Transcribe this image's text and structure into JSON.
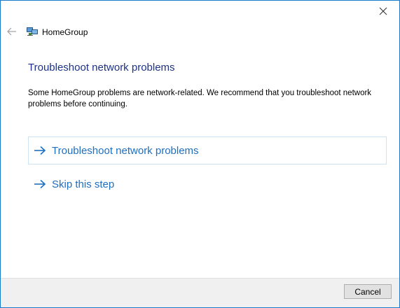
{
  "window": {
    "title": "HomeGroup",
    "close_icon": "close-icon",
    "back_icon": "back-arrow-icon",
    "app_icon": "homegroup-icon"
  },
  "main": {
    "heading": "Troubleshoot network problems",
    "description": "Some HomeGroup problems are network-related. We recommend that you troubleshoot network problems before continuing.",
    "options": [
      {
        "label": "Troubleshoot network problems",
        "icon": "arrow-right-icon"
      },
      {
        "label": "Skip this step",
        "icon": "arrow-right-icon"
      }
    ]
  },
  "footer": {
    "cancel_label": "Cancel"
  },
  "colors": {
    "window_border": "#1979ca",
    "heading": "#1e3287",
    "link": "#1e6fc0",
    "footer_bg": "#f0f0f0"
  }
}
